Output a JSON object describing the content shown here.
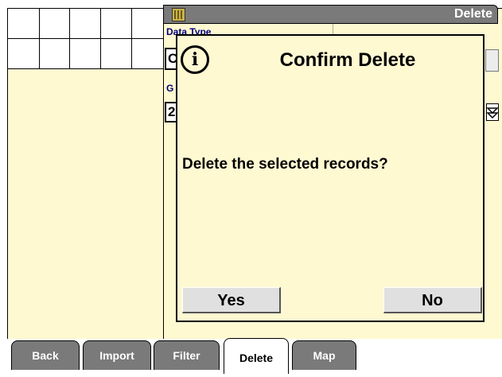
{
  "titlebar": {
    "title": "Delete",
    "icon": "folder-data-icon"
  },
  "fields": {
    "data_type_label": "Data Type",
    "data_type_value": "C",
    "group_label": "G",
    "group_value": "2"
  },
  "dialog": {
    "icon": "info-icon",
    "icon_glyph": "i",
    "title": "Confirm Delete",
    "message": "Delete the selected records?",
    "yes_label": "Yes",
    "no_label": "No"
  },
  "tabs": [
    {
      "label": "Back"
    },
    {
      "label": "Import"
    },
    {
      "label": "Filter"
    },
    {
      "label": "Delete",
      "active": true
    },
    {
      "label": "Map"
    }
  ],
  "colors": {
    "panel": "#fff9d2",
    "tab": "#7a7a7a",
    "titlebar": "#7a7a7a",
    "field_label": "#00007a"
  }
}
